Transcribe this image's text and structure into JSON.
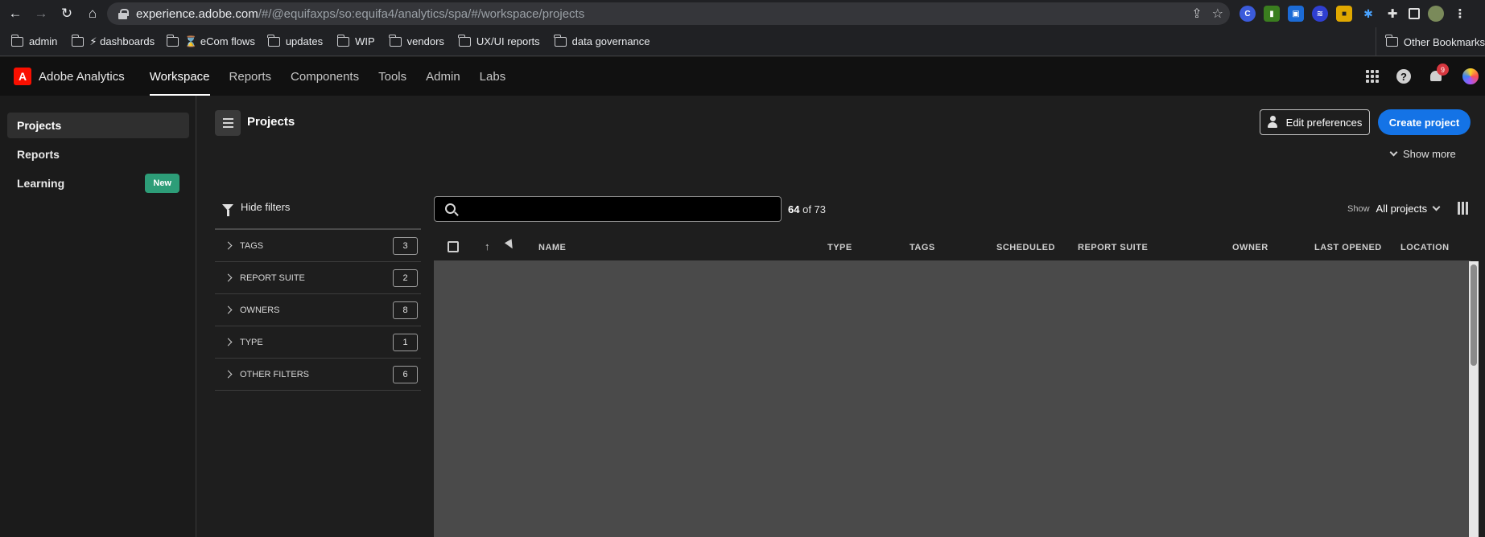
{
  "browser": {
    "url_domain": "experience.adobe.com",
    "url_path": "/#/@equifaxps/so:equifa4/analytics/spa/#/workspace/projects",
    "bookmarks": [
      "admin",
      "⚡ dashboards",
      "⌛ eCom flows",
      "updates",
      "WIP",
      "vendors",
      "UX/UI reports",
      "data governance"
    ],
    "other_bookmarks": "Other Bookmarks"
  },
  "app": {
    "title": "Adobe Analytics",
    "nav": [
      "Workspace",
      "Reports",
      "Components",
      "Tools",
      "Admin",
      "Labs"
    ],
    "notification_count": "9"
  },
  "rail": {
    "items": [
      "Projects",
      "Reports",
      "Learning"
    ],
    "new_badge": "New"
  },
  "page": {
    "title": "Projects",
    "edit_preferences": "Edit preferences",
    "create_project": "Create project",
    "show_more": "Show more"
  },
  "filters": {
    "hide_label": "Hide filters",
    "rows": [
      {
        "label": "TAGS",
        "count": "3"
      },
      {
        "label": "REPORT SUITE",
        "count": "2"
      },
      {
        "label": "OWNERS",
        "count": "8"
      },
      {
        "label": "TYPE",
        "count": "1"
      },
      {
        "label": "OTHER FILTERS",
        "count": "6"
      }
    ]
  },
  "list": {
    "shown": "64",
    "of_text": "of 73",
    "show_label": "Show",
    "show_value": "All projects",
    "columns": [
      "NAME",
      "TYPE",
      "TAGS",
      "SCHEDULED",
      "REPORT SUITE",
      "OWNER",
      "LAST OPENED",
      "LOCATION"
    ]
  },
  "colors": {
    "accent": "#1473e6",
    "new_badge": "#2d9d78",
    "adobe_red": "#fa0f00"
  }
}
